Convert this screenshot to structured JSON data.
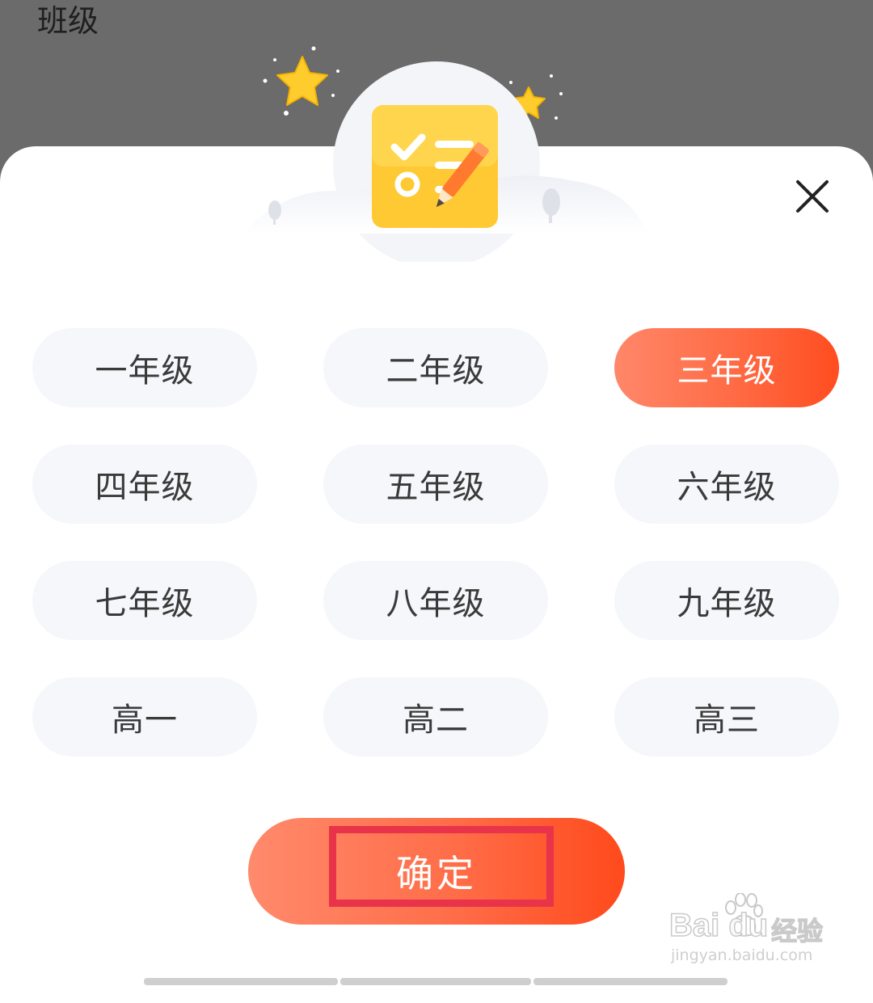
{
  "backdrop": {
    "title": "班级"
  },
  "grades": [
    {
      "label": "一年级",
      "selected": false
    },
    {
      "label": "二年级",
      "selected": false
    },
    {
      "label": "三年级",
      "selected": true
    },
    {
      "label": "四年级",
      "selected": false
    },
    {
      "label": "五年级",
      "selected": false
    },
    {
      "label": "六年级",
      "selected": false
    },
    {
      "label": "七年级",
      "selected": false
    },
    {
      "label": "八年级",
      "selected": false
    },
    {
      "label": "九年级",
      "selected": false
    },
    {
      "label": "高一",
      "selected": false
    },
    {
      "label": "高二",
      "selected": false
    },
    {
      "label": "高三",
      "selected": false
    }
  ],
  "confirm": {
    "label": "确定"
  },
  "watermark": {
    "brand": "Bai  du",
    "suffix": "经验",
    "url": "jingyan.baidu.com"
  },
  "icons": {
    "close": "close-icon",
    "hero": "checklist-pencil-icon",
    "stars": "star-icon"
  },
  "colors": {
    "accent_start": "#ff876a",
    "accent_end": "#ff4d20",
    "highlight_box": "#e8334a",
    "chip_background": "#f6f7fa",
    "hero_card": "#ffc837"
  }
}
